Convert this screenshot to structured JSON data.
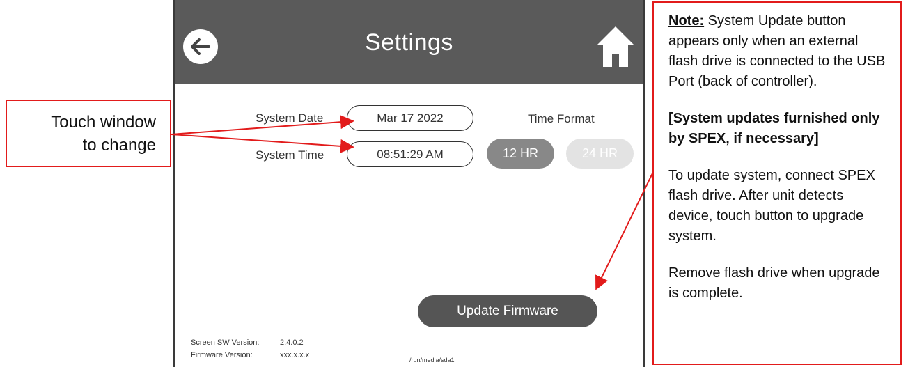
{
  "screen": {
    "title": "Settings",
    "system_date_label": "System Date",
    "system_date_value": "Mar 17 2022",
    "system_time_label": "System Time",
    "system_time_value": "08:51:29 AM",
    "time_format_label": "Time Format",
    "format_12": "12 HR",
    "format_24": "24 HR",
    "update_button": "Update Firmware",
    "screen_sw_label": "Screen SW Version:",
    "screen_sw_value": "2.4.0.2",
    "firmware_label": "Firmware Version:",
    "firmware_value": "xxx.x.x.x",
    "media_path": "/run/media/sda1"
  },
  "callouts": {
    "left_line1": "Touch window",
    "left_line2": "to change",
    "note_heading": "Note:",
    "note_text": " System Update button appears only when an external flash drive is connected to the USB Port (back of controller).",
    "note_bold": "[System updates furnished only by SPEX, if necessary]",
    "note_para3": "To update system, connect SPEX flash drive.  After unit detects device, touch button to upgrade system.",
    "note_para4": "Remove flash drive when upgrade is complete."
  },
  "colors": {
    "header": "#5a5a5a",
    "accent_red": "#e21b1b",
    "pill_active": "#888888",
    "pill_inactive": "#e3e3e3"
  },
  "icons": [
    "back-arrow-icon",
    "home-icon"
  ]
}
